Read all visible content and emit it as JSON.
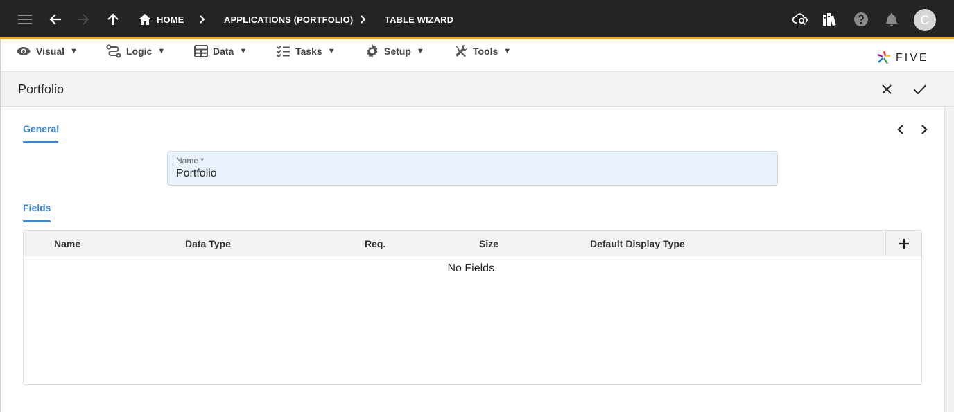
{
  "appbar": {
    "breadcrumbs": [
      "HOME",
      "APPLICATIONS (PORTFOLIO)",
      "TABLE WIZARD"
    ],
    "avatar_initial": "C",
    "icons": [
      "menu-icon",
      "back-arrow-icon",
      "forward-arrow-icon",
      "up-arrow-icon",
      "home-icon",
      "cloud-search-icon",
      "library-icon",
      "help-icon",
      "bell-icon"
    ]
  },
  "menubar": {
    "items": [
      {
        "label": "Visual",
        "icon": "eye-icon"
      },
      {
        "label": "Logic",
        "icon": "flow-icon"
      },
      {
        "label": "Data",
        "icon": "table-icon"
      },
      {
        "label": "Tasks",
        "icon": "checklist-icon"
      },
      {
        "label": "Setup",
        "icon": "gear-icon"
      },
      {
        "label": "Tools",
        "icon": "tools-icon"
      }
    ],
    "caret": "▼",
    "logo_text": "FIVE"
  },
  "titlebar": {
    "title": "Portfolio"
  },
  "form": {
    "general_tab": "General",
    "name_label": "Name *",
    "name_value": "Portfolio",
    "fields_tab": "Fields"
  },
  "table": {
    "columns": [
      "Name",
      "Data Type",
      "Req.",
      "Size",
      "Default Display Type"
    ],
    "empty_message": "No Fields."
  },
  "colors": {
    "appbar_bg": "#242424",
    "accent_orange": "#f3a51d",
    "tab_blue": "#3d86d3",
    "field_bg": "#e8f1fc"
  }
}
